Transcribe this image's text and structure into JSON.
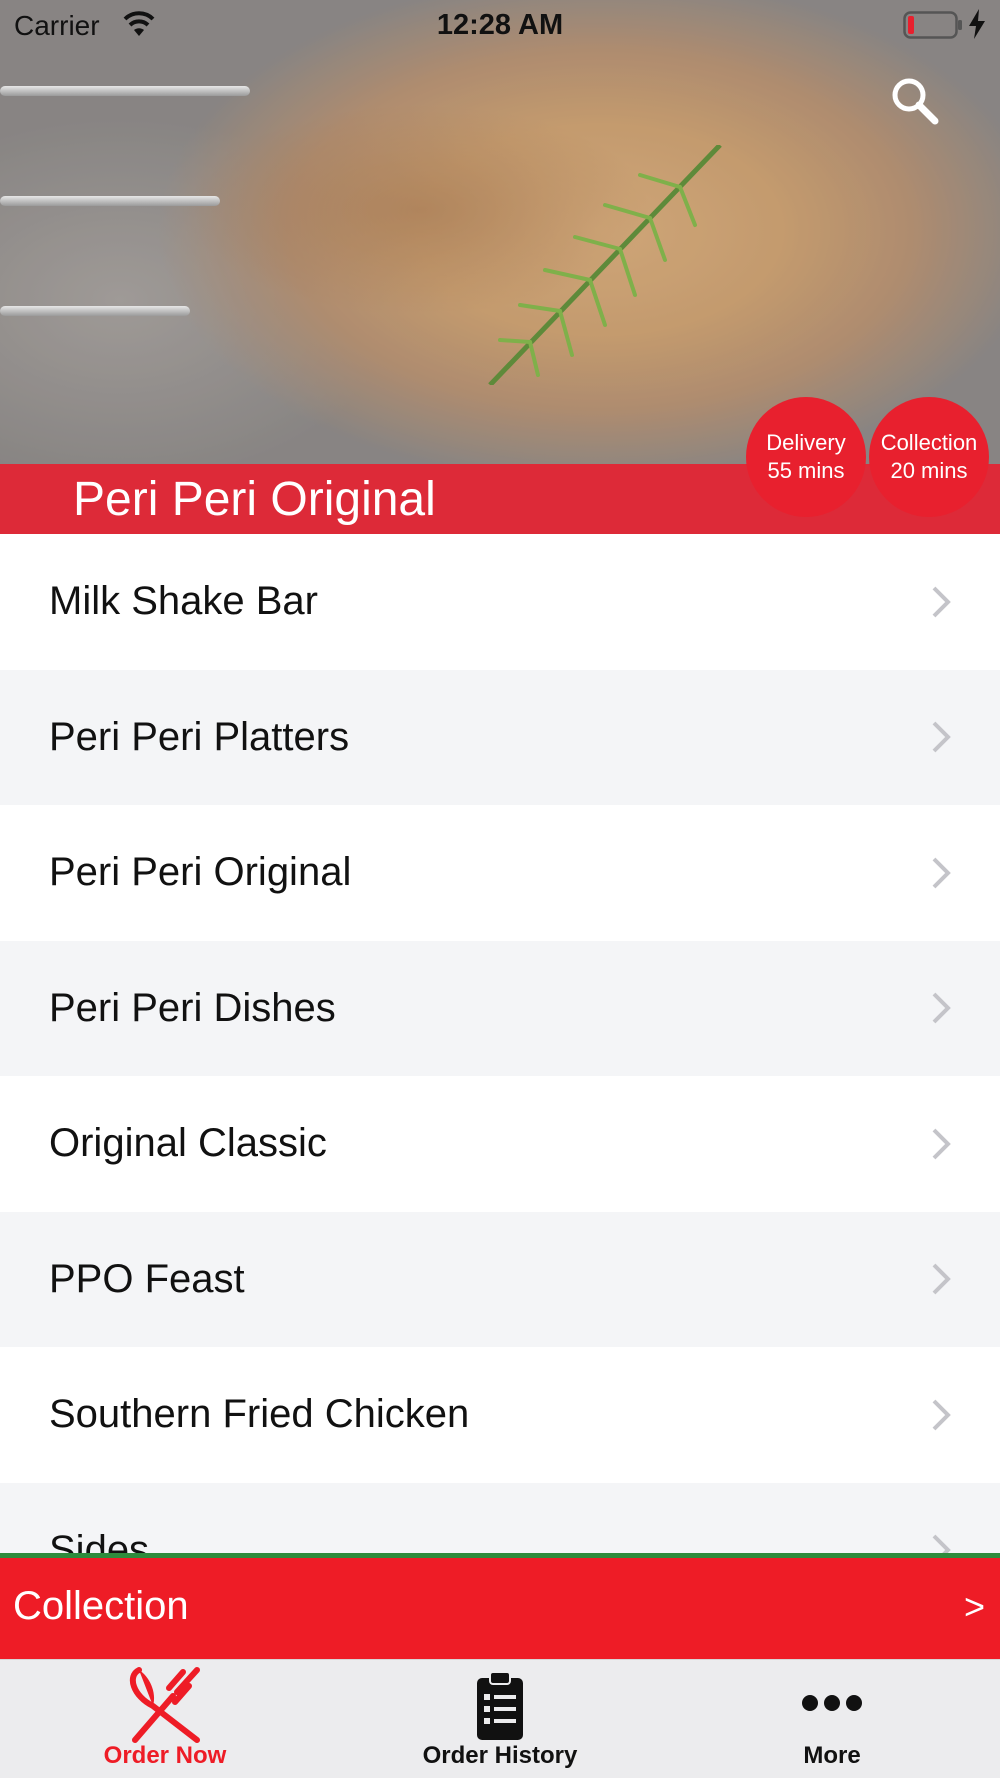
{
  "status_bar": {
    "carrier": "Carrier",
    "time": "12:28 AM"
  },
  "header": {
    "title": "Peri Peri Original",
    "delivery": {
      "label": "Delivery",
      "time": "55 mins"
    },
    "collection": {
      "label": "Collection",
      "time": "20 mins"
    }
  },
  "menu": {
    "items": [
      {
        "label": "Milk Shake Bar"
      },
      {
        "label": "Peri Peri Platters"
      },
      {
        "label": "Peri Peri Original"
      },
      {
        "label": "Peri Peri Dishes"
      },
      {
        "label": "Original Classic"
      },
      {
        "label": "PPO Feast"
      },
      {
        "label": "Southern Fried Chicken"
      },
      {
        "label": "Sides"
      }
    ]
  },
  "order_mode": {
    "label": "Collection",
    "arrow": ">"
  },
  "tabs": [
    {
      "label": "Order Now",
      "icon": "fork-knife-icon",
      "active": true
    },
    {
      "label": "Order History",
      "icon": "clipboard-icon",
      "active": false
    },
    {
      "label": "More",
      "icon": "more-dots-icon",
      "active": false
    }
  ],
  "colors": {
    "accent_red": "#ee1c26",
    "divider_green": "#2e8b3c",
    "tab_bar_bg": "#ececee"
  }
}
